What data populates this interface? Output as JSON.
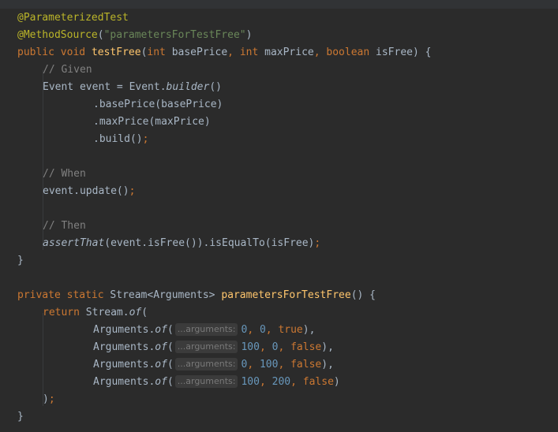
{
  "code": {
    "l1_annotation": "@ParameterizedTest",
    "l2_annotation": "@MethodSource",
    "l2_paren_open": "(",
    "l2_string": "\"parametersForTestFree\"",
    "l2_paren_close": ")",
    "l3_public": "public",
    "l3_void": "void",
    "l3_method": "testFree",
    "l3_p1_type": "int",
    "l3_p1_name": "basePrice",
    "l3_p2_type": "int",
    "l3_p2_name": "maxPrice",
    "l3_p3_type": "boolean",
    "l3_p3_name": "isFree",
    "l4_comment": "// Given",
    "l5_decl": "Event event = Event.",
    "l5_builder": "builder",
    "l5_tail": "()",
    "l6_text": ".basePrice(basePrice)",
    "l7_text": ".maxPrice(maxPrice)",
    "l8_text": ".build()",
    "semicolon": ";",
    "comma": ",",
    "l10_comment": "// When",
    "l11_text": "event.update()",
    "l13_comment": "// Then",
    "l14_assert": "assertThat",
    "l14_text": "(event.isFree()).isEqualTo(isFree)",
    "close_brace": "}",
    "l17_private": "private",
    "l17_static": "static",
    "l17_type": "Stream<Arguments>",
    "l17_method": "parametersForTestFree",
    "l17_tail": "() {",
    "l3_open": ") {",
    "l18_return": "return",
    "l18_stream": "Stream.",
    "l18_of": "of",
    "l18_paren": "(",
    "args_prefix": "Arguments.",
    "args_of": "of",
    "args_open": "(",
    "hint_label": "...arguments:",
    "row1": {
      "a": "0",
      "b": "0",
      "c": "true",
      "end": "),"
    },
    "row2": {
      "a": "100",
      "b": "0",
      "c": "false",
      "end": "),"
    },
    "row3": {
      "a": "0",
      "b": "100",
      "c": "false",
      "end": "),"
    },
    "row4": {
      "a": "100",
      "b": "200",
      "c": "false",
      "end": ")"
    },
    "l23_close": ")",
    "colors": {
      "background": "#2b2b2b",
      "keyword": "#cc7832",
      "annotation": "#bbb529",
      "method": "#ffc66d",
      "string": "#6a8759",
      "number": "#6897bb",
      "comment": "#808080",
      "text": "#a9b7c6"
    }
  }
}
